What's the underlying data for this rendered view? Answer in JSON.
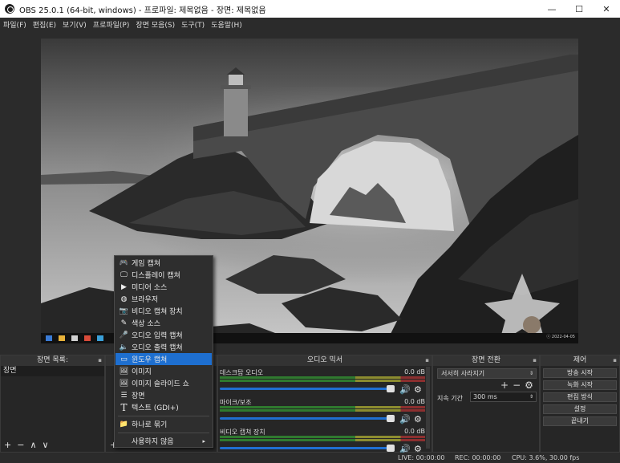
{
  "window": {
    "title": "OBS 25.0.1 (64-bit, windows) - 프로파일: 제목없음 - 장면: 제목없음",
    "minimize": "—",
    "maximize": "☐",
    "close": "✕"
  },
  "menu": [
    "파일(F)",
    "편집(E)",
    "보기(V)",
    "프로파일(P)",
    "장면 모음(S)",
    "도구(T)",
    "도움말(H)"
  ],
  "preview": {
    "watermark": "ⓒ 2022-04-05"
  },
  "scenes": {
    "title": "장면 목록:",
    "items": [
      "장면"
    ],
    "buttons": [
      "+",
      "−",
      "∧",
      "∨"
    ]
  },
  "sources": {
    "add": "+"
  },
  "context_menu": {
    "items": [
      {
        "icon": "gamepad-icon",
        "glyph": "🎮",
        "label": "게임 캡쳐"
      },
      {
        "icon": "monitor-icon",
        "glyph": "🖵",
        "label": "디스플레이 캡쳐"
      },
      {
        "icon": "play-icon",
        "glyph": "▶",
        "label": "미디어 소스"
      },
      {
        "icon": "globe-icon",
        "glyph": "◍",
        "label": "브라우저"
      },
      {
        "icon": "camera-icon",
        "glyph": "📷",
        "label": "비디오 캡쳐 장치"
      },
      {
        "icon": "brush-icon",
        "glyph": "✎",
        "label": "색상 소스"
      },
      {
        "icon": "mic-icon",
        "glyph": "🎤",
        "label": "오디오 입력 캡쳐"
      },
      {
        "icon": "speaker-icon",
        "glyph": "🔈",
        "label": "오디오 출력 캡쳐"
      },
      {
        "icon": "window-icon",
        "glyph": "▭",
        "label": "윈도우 캡쳐"
      },
      {
        "icon": "image-icon",
        "glyph": "🖼",
        "label": "이미지"
      },
      {
        "icon": "slideshow-icon",
        "glyph": "🖼",
        "label": "이미지 슬라이드 쇼"
      },
      {
        "icon": "list-icon",
        "glyph": "☰",
        "label": "장면"
      },
      {
        "icon": "text-icon",
        "glyph": "T",
        "label": "텍스트 (GDI+)"
      }
    ],
    "group": {
      "icon": "folder-icon",
      "glyph": "📁",
      "label": "하나로 묶기"
    },
    "deprecated": {
      "label": "사용하지 않음",
      "arrow": "▸"
    },
    "selected": "윈도우 캡쳐"
  },
  "mixer": {
    "title": "오디오 믹서",
    "channels": [
      {
        "name": "데스크탑 오디오",
        "db": "0.0 dB"
      },
      {
        "name": "마이크/보조",
        "db": "0.0 dB"
      },
      {
        "name": "비디오 캡쳐 장치",
        "db": "0.0 dB"
      }
    ],
    "ticks": [
      "-60",
      "-55",
      "-50",
      "-45",
      "-40",
      "-35",
      "-30",
      "-25",
      "-20",
      "-15",
      "-10",
      "-5",
      "0"
    ]
  },
  "transitions": {
    "title": "장면 전환",
    "selected": "서서히 사라지기",
    "duration_label": "지속 기간",
    "duration_value": "300 ms",
    "plus": "+",
    "minus": "−"
  },
  "controls": {
    "title": "제어",
    "buttons": [
      "방송 시작",
      "녹화 시작",
      "편집 방식",
      "설정",
      "끝내기"
    ]
  },
  "status": {
    "live": "LIVE: 00:00:00",
    "rec": "REC: 00:00:00",
    "cpu": "CPU: 3.6%, 30.00 fps"
  }
}
